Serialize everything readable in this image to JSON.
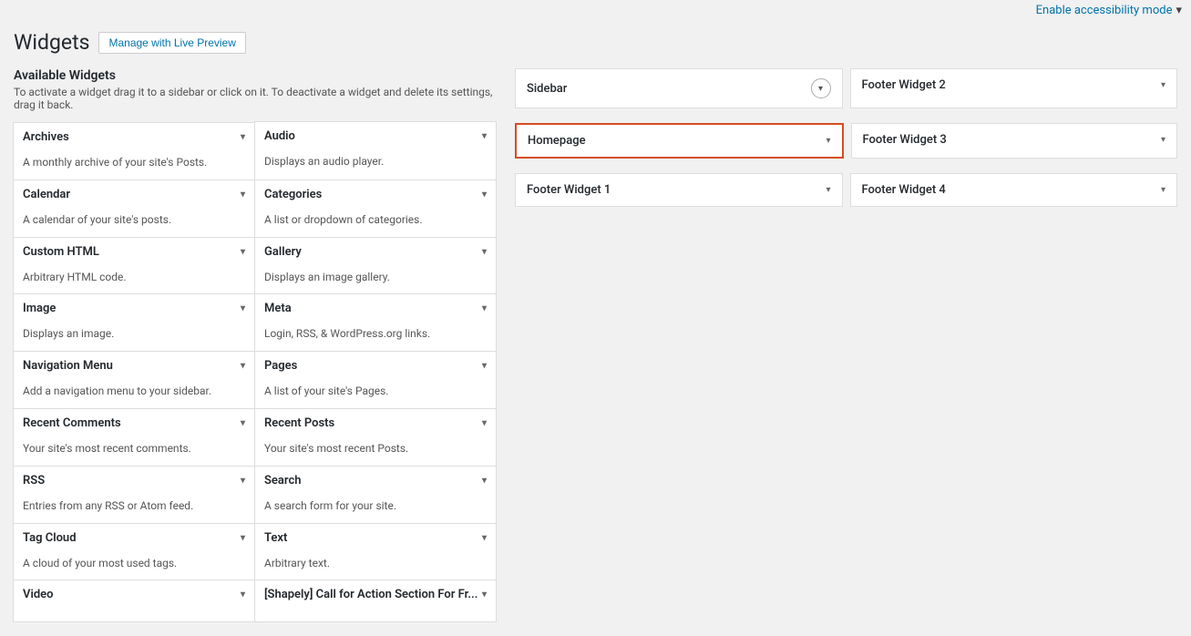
{
  "topBar": {
    "accessibilityLink": "Enable accessibility mode",
    "separator": "▾"
  },
  "header": {
    "title": "Widgets",
    "manageBtn": "Manage with Live Preview"
  },
  "availableWidgets": {
    "heading": "Available Widgets",
    "subtitle": "To activate a widget drag it to a sidebar or click on it. To deactivate a widget and delete its settings, drag it back.",
    "widgets": [
      {
        "name": "Archives",
        "desc": "A monthly archive of your site's Posts."
      },
      {
        "name": "Audio",
        "desc": "Displays an audio player."
      },
      {
        "name": "Calendar",
        "desc": "A calendar of your site's posts."
      },
      {
        "name": "Categories",
        "desc": "A list or dropdown of categories."
      },
      {
        "name": "Custom HTML",
        "desc": "Arbitrary HTML code."
      },
      {
        "name": "Gallery",
        "desc": "Displays an image gallery."
      },
      {
        "name": "Image",
        "desc": "Displays an image."
      },
      {
        "name": "Meta",
        "desc": "Login, RSS, & WordPress.org links."
      },
      {
        "name": "Navigation Menu",
        "desc": "Add a navigation menu to your sidebar."
      },
      {
        "name": "Pages",
        "desc": "A list of your site's Pages."
      },
      {
        "name": "Recent Comments",
        "desc": "Your site's most recent comments."
      },
      {
        "name": "Recent Posts",
        "desc": "Your site's most recent Posts."
      },
      {
        "name": "RSS",
        "desc": "Entries from any RSS or Atom feed."
      },
      {
        "name": "Search",
        "desc": "A search form for your site."
      },
      {
        "name": "Tag Cloud",
        "desc": "A cloud of your most used tags."
      },
      {
        "name": "Text",
        "desc": "Arbitrary text."
      },
      {
        "name": "Video",
        "desc": ""
      },
      {
        "name": "[Shapely] Call for Action Section For Fr...",
        "desc": ""
      }
    ]
  },
  "sidebarAreas": {
    "areas": [
      {
        "name": "Sidebar",
        "circleChevron": true,
        "selected": false
      },
      {
        "name": "Homepage",
        "circleChevron": false,
        "selected": true
      },
      {
        "name": "Footer Widget 1",
        "circleChevron": false,
        "selected": false
      },
      {
        "name": "Footer Widget 2",
        "circleChevron": false,
        "selected": false
      },
      {
        "name": "Footer Widget 3",
        "circleChevron": false,
        "selected": false
      },
      {
        "name": "Footer Widget 4",
        "circleChevron": false,
        "selected": false
      }
    ]
  },
  "chevron": "▾"
}
